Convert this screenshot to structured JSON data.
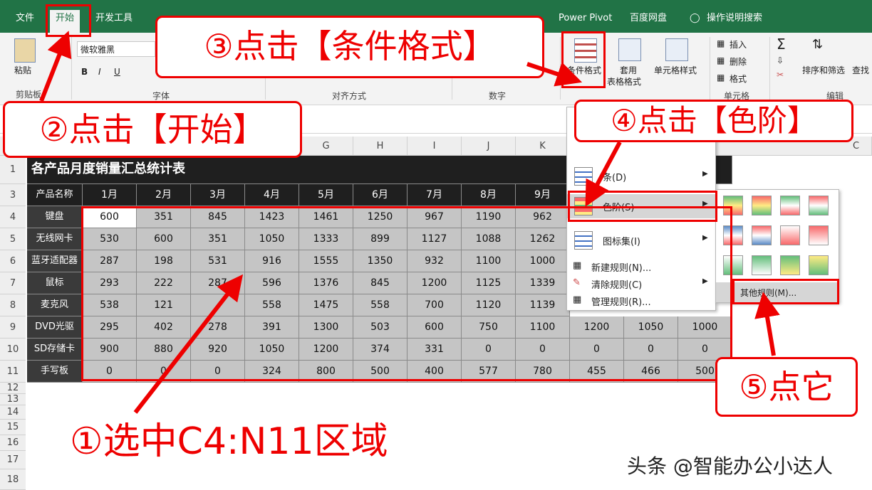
{
  "tabs": [
    "文件",
    "开始",
    "开发工具",
    "Power Pivot",
    "百度网盘",
    "操作说明搜索"
  ],
  "ribbon": {
    "paste": "粘贴",
    "clipboard": "剪贴板",
    "font_name": "微软雅黑",
    "font_group": "字体",
    "align_group": "对齐方式",
    "number_group": "数字",
    "cond_format": "条件格式",
    "table_format_1": "套用",
    "table_format_2": "表格格式",
    "cell_style": "单元格样式",
    "insert": "插入",
    "delete": "删除",
    "format": "格式",
    "cells_group": "单元格",
    "sort_filter": "排序和筛选",
    "find": "查找",
    "edit_group": "编辑",
    "bold": "B",
    "italic": "I",
    "underline": "U"
  },
  "sheet": {
    "columns": [
      "G",
      "H",
      "I",
      "J",
      "K"
    ],
    "col_extra": "C",
    "row_numbers": [
      "1",
      "3",
      "4",
      "5",
      "6",
      "7",
      "8",
      "9",
      "10",
      "11",
      "12",
      "13",
      "14",
      "15",
      "16",
      "17",
      "18"
    ],
    "title": "各产品月度销量汇总统计表",
    "header_label": "产品名称",
    "months": [
      "1月",
      "2月",
      "3月",
      "4月",
      "5月",
      "6月",
      "7月",
      "8月",
      "9月"
    ],
    "products": [
      {
        "name": "键盘",
        "values": [
          "600",
          "351",
          "845",
          "1423",
          "1461",
          "1250",
          "967",
          "1190",
          "962"
        ]
      },
      {
        "name": "无线网卡",
        "values": [
          "530",
          "600",
          "351",
          "1050",
          "1333",
          "899",
          "1127",
          "1088",
          "1262"
        ]
      },
      {
        "name": "蓝牙适配器",
        "values": [
          "287",
          "198",
          "531",
          "916",
          "1555",
          "1350",
          "932",
          "1100",
          "1000"
        ]
      },
      {
        "name": "鼠标",
        "values": [
          "293",
          "222",
          "287",
          "596",
          "1376",
          "845",
          "1200",
          "1125",
          "1339"
        ]
      },
      {
        "name": "麦克风",
        "values": [
          "538",
          "121",
          "",
          "558",
          "1475",
          "558",
          "700",
          "1120",
          "1139"
        ]
      },
      {
        "name": "DVD光驱",
        "values": [
          "295",
          "402",
          "278",
          "391",
          "1300",
          "503",
          "600",
          "750",
          "1100",
          "1200",
          "1050",
          "1000"
        ]
      },
      {
        "name": "SD存储卡",
        "values": [
          "900",
          "880",
          "920",
          "1050",
          "1200",
          "374",
          "331",
          "0",
          "0",
          "0",
          "0",
          "0"
        ]
      },
      {
        "name": "手写板",
        "values": [
          "0",
          "0",
          "0",
          "324",
          "800",
          "500",
          "400",
          "577",
          "780",
          "455",
          "466",
          "500"
        ]
      }
    ]
  },
  "cf_menu": {
    "items": [
      "条(D)",
      "色阶(S)",
      "图标集(I)",
      "新建规则(N)...",
      "清除规则(C)",
      "管理规则(R)..."
    ]
  },
  "scale_menu": {
    "more_rules": "其他规则(M)..."
  },
  "annotations": {
    "step1": "①选中C4:N11区域",
    "step2": "②点击【开始】",
    "step3": "③点击【条件格式】",
    "step4": "④点击【色阶】",
    "step5": "⑤点它"
  },
  "watermark": "头条 @智能办公小达人",
  "colors": {
    "ribbon_green": "#217346",
    "annotation_red": "#e00000",
    "header_dark": "#1f1f1f",
    "data_gray": "#c5c5c5"
  }
}
